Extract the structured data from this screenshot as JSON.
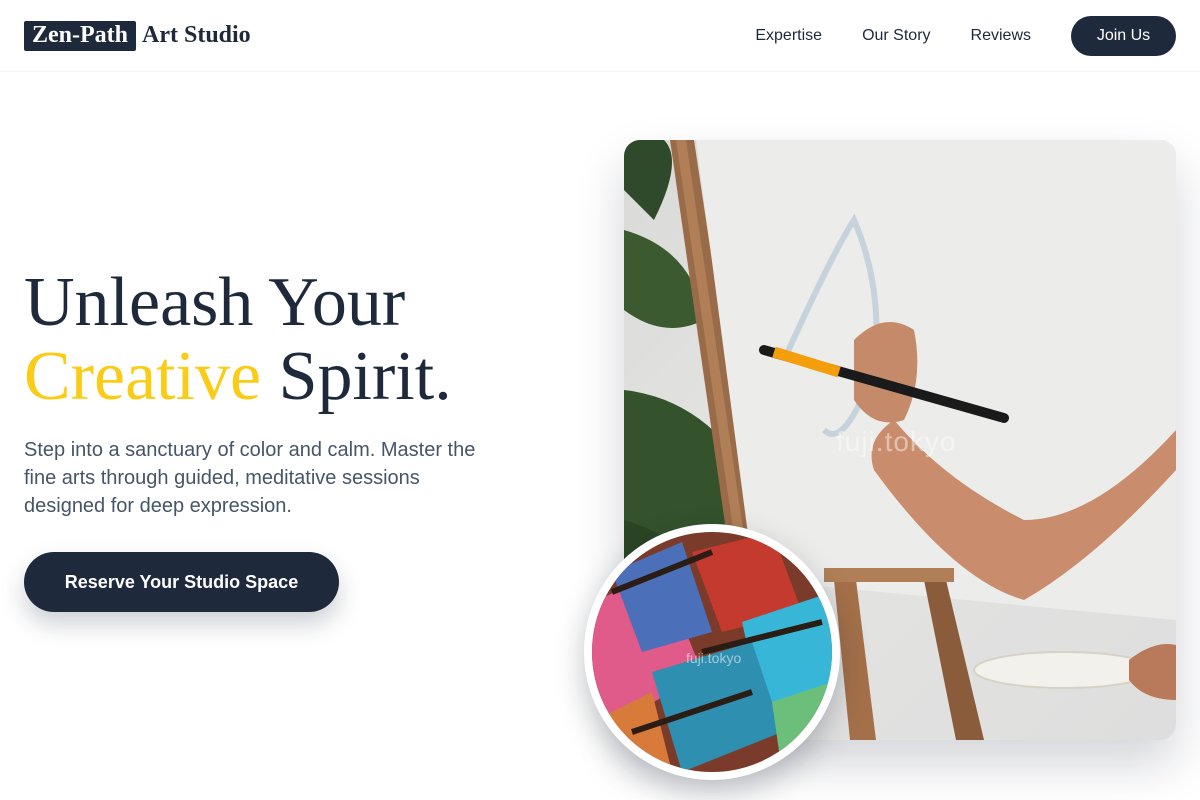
{
  "header": {
    "brand_box": "Zen-Path",
    "brand_rest": "Art Studio",
    "nav": [
      "Expertise",
      "Our Story",
      "Reviews"
    ],
    "join_label": "Join Us"
  },
  "hero": {
    "title_line1": "Unleash Your",
    "title_accent": "Creative",
    "title_rest": " Spirit.",
    "description": "Step into a sanctuary of color and calm. Master the fine arts through guided, meditative sessions designed for deep expression.",
    "cta_label": "Reserve Your Studio Space"
  },
  "images": {
    "main_watermark": "fuji.tokyo",
    "circle_watermark": "fuji.tokyo"
  },
  "colors": {
    "primary": "#1e293b",
    "accent": "#facc15",
    "text_muted": "#475569"
  }
}
